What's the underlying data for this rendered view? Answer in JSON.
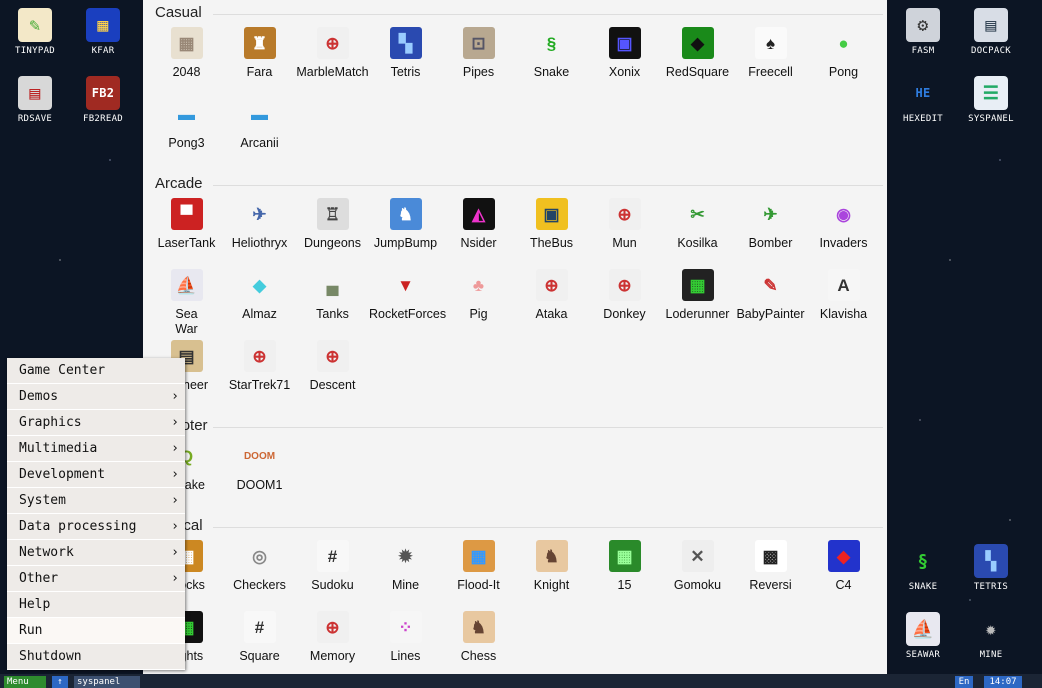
{
  "desktop_left": [
    {
      "label": "TINYPAD",
      "glyph": "✎",
      "bg": "#f3e8c8",
      "fg": "#4a3"
    },
    {
      "label": "KFAR",
      "glyph": "▦",
      "bg": "#1a3fbf",
      "fg": "#ffd24a"
    },
    {
      "label": "RDSAVE",
      "glyph": "▤",
      "bg": "#d8d8d8",
      "fg": "#b22"
    },
    {
      "label": "FB2READ",
      "glyph": "FB2",
      "bg": "#a02a22",
      "fg": "#fff"
    }
  ],
  "desktop_right": [
    {
      "label": "FASM",
      "glyph": "⚙",
      "bg": "#cfd3da",
      "fg": "#333"
    },
    {
      "label": "DOCPACK",
      "glyph": "▤",
      "bg": "#d8dde6",
      "fg": "#345"
    },
    {
      "label": "HEXEDIT",
      "glyph": "HE",
      "bg": "transparent",
      "fg": "#2f7de0"
    },
    {
      "label": "SYSPANEL",
      "glyph": "☰",
      "bg": "#e8eef5",
      "fg": "#2a6"
    },
    {
      "label": "SNAKE",
      "glyph": "§",
      "bg": "transparent",
      "fg": "#3c3"
    },
    {
      "label": "TETRIS",
      "glyph": "▚",
      "bg": "#2a4ab0",
      "fg": "#9cf"
    },
    {
      "label": "SEAWAR",
      "glyph": "⛵",
      "bg": "#e8e8f0",
      "fg": "#446"
    },
    {
      "label": "MINE",
      "glyph": "✹",
      "bg": "transparent",
      "fg": "#bbb"
    }
  ],
  "sections": [
    {
      "title": "Casual",
      "apps": [
        {
          "name": "2048",
          "glyph": "▦",
          "bg": "#e8e0d0",
          "fg": "#987"
        },
        {
          "name": "Fara",
          "glyph": "♜",
          "bg": "#b87a2a",
          "fg": "#fff"
        },
        {
          "name": "MarbleMatch",
          "glyph": "⊕",
          "bg": "#f0f0f0",
          "fg": "#c33"
        },
        {
          "name": "Tetris",
          "glyph": "▚",
          "bg": "#2a4ab0",
          "fg": "#9cf"
        },
        {
          "name": "Pipes",
          "glyph": "⊡",
          "bg": "#b8a890",
          "fg": "#556"
        },
        {
          "name": "Snake",
          "glyph": "§",
          "bg": "transparent",
          "fg": "#2a2"
        },
        {
          "name": "Xonix",
          "glyph": "▣",
          "bg": "#111",
          "fg": "#55f"
        },
        {
          "name": "RedSquare",
          "glyph": "◆",
          "bg": "#1a8a1a",
          "fg": "#111"
        },
        {
          "name": "Freecell",
          "glyph": "♠",
          "bg": "#fafafa",
          "fg": "#222"
        },
        {
          "name": "Pong",
          "glyph": "●",
          "bg": "transparent",
          "fg": "#4c4"
        },
        {
          "name": "Pong3",
          "glyph": "▬",
          "bg": "transparent",
          "fg": "#39d"
        },
        {
          "name": "Arcanii",
          "glyph": "▬",
          "bg": "transparent",
          "fg": "#39d"
        }
      ]
    },
    {
      "title": "Arcade",
      "apps": [
        {
          "name": "LaserTank",
          "glyph": "▀",
          "bg": "#c22",
          "fg": "#fff"
        },
        {
          "name": "Heliothryx",
          "glyph": "✈",
          "bg": "transparent",
          "fg": "#46a"
        },
        {
          "name": "Dungeons",
          "glyph": "♖",
          "bg": "#ddd",
          "fg": "#444"
        },
        {
          "name": "JumpBump",
          "glyph": "♞",
          "bg": "#4a8ad8",
          "fg": "#fff"
        },
        {
          "name": "Nsider",
          "glyph": "◭",
          "bg": "#111",
          "fg": "#e3c"
        },
        {
          "name": "TheBus",
          "glyph": "▣",
          "bg": "#f0c020",
          "fg": "#246"
        },
        {
          "name": "Mun",
          "glyph": "⊕",
          "bg": "#f0f0f0",
          "fg": "#c33"
        },
        {
          "name": "Kosilka",
          "glyph": "✂",
          "bg": "transparent",
          "fg": "#393"
        },
        {
          "name": "Bomber",
          "glyph": "✈",
          "bg": "transparent",
          "fg": "#393"
        },
        {
          "name": "Invaders",
          "glyph": "◉",
          "bg": "transparent",
          "fg": "#a4d"
        },
        {
          "name": "Sea\nWar",
          "glyph": "⛵",
          "bg": "#e8e8f0",
          "fg": "#446"
        },
        {
          "name": "Almaz",
          "glyph": "◆",
          "bg": "transparent",
          "fg": "#4cd"
        },
        {
          "name": "Tanks",
          "glyph": "▄",
          "bg": "transparent",
          "fg": "#786"
        },
        {
          "name": "RocketForces",
          "glyph": "▼",
          "bg": "transparent",
          "fg": "#c22"
        },
        {
          "name": "Pig",
          "glyph": "♣",
          "bg": "transparent",
          "fg": "#e99"
        },
        {
          "name": "Ataka",
          "glyph": "⊕",
          "bg": "#f0f0f0",
          "fg": "#c33"
        },
        {
          "name": "Donkey",
          "glyph": "⊕",
          "bg": "#f0f0f0",
          "fg": "#c33"
        },
        {
          "name": "Loderunner",
          "glyph": "▦",
          "bg": "#222",
          "fg": "#3c3"
        },
        {
          "name": "BabyPainter",
          "glyph": "✎",
          "bg": "transparent",
          "fg": "#c33"
        },
        {
          "name": "Klavisha",
          "glyph": "A",
          "bg": "#f6f6f6",
          "fg": "#333"
        },
        {
          "name": "Pioneer",
          "glyph": "▤",
          "bg": "#d8c090",
          "fg": "#333"
        },
        {
          "name": "StarTrek71",
          "glyph": "⊕",
          "bg": "#f0f0f0",
          "fg": "#c33"
        },
        {
          "name": "Descent",
          "glyph": "⊕",
          "bg": "#f0f0f0",
          "fg": "#c33"
        }
      ]
    },
    {
      "title": "Shooter",
      "apps": [
        {
          "name": "Quake",
          "glyph": "Q",
          "bg": "transparent",
          "fg": "#7a2"
        },
        {
          "name": "DOOM1",
          "glyph": "DOOM",
          "bg": "transparent",
          "fg": "#c63"
        }
      ]
    },
    {
      "title": "Logical",
      "apps": [
        {
          "name": "Blocks",
          "glyph": "▦",
          "bg": "#c82",
          "fg": "#fff"
        },
        {
          "name": "Checkers",
          "glyph": "◎",
          "bg": "transparent",
          "fg": "#888"
        },
        {
          "name": "Sudoku",
          "glyph": "#",
          "bg": "#f8f8f8",
          "fg": "#333"
        },
        {
          "name": "Mine",
          "glyph": "✹",
          "bg": "transparent",
          "fg": "#555"
        },
        {
          "name": "Flood-It",
          "glyph": "▦",
          "bg": "#d94",
          "fg": "#39f"
        },
        {
          "name": "Knight",
          "glyph": "♞",
          "bg": "#e8c8a0",
          "fg": "#643"
        },
        {
          "name": "15",
          "glyph": "▦",
          "bg": "#2a8a2a",
          "fg": "#9f9"
        },
        {
          "name": "Gomoku",
          "glyph": "✕",
          "bg": "#eee",
          "fg": "#555"
        },
        {
          "name": "Reversi",
          "glyph": "▩",
          "bg": "#fff",
          "fg": "#222"
        },
        {
          "name": "C4",
          "glyph": "◆",
          "bg": "#2233cc",
          "fg": "#e22"
        },
        {
          "name": "Lights",
          "glyph": "▦",
          "bg": "#111",
          "fg": "#3c3"
        },
        {
          "name": "Square",
          "glyph": "#",
          "bg": "#f8f8f8",
          "fg": "#333"
        },
        {
          "name": "Memory",
          "glyph": "⊕",
          "bg": "#f0f0f0",
          "fg": "#c33"
        },
        {
          "name": "Lines",
          "glyph": "⁘",
          "bg": "#f6f6f6",
          "fg": "#c4c"
        },
        {
          "name": "Chess",
          "glyph": "♞",
          "bg": "#e8c8a0",
          "fg": "#643"
        }
      ]
    }
  ],
  "menu": [
    {
      "label": "Game Center",
      "sub": false,
      "hl": false
    },
    {
      "label": "Demos",
      "sub": true,
      "hl": false
    },
    {
      "label": "Graphics",
      "sub": true,
      "hl": false
    },
    {
      "label": "Multimedia",
      "sub": true,
      "hl": false
    },
    {
      "label": "Development",
      "sub": true,
      "hl": false
    },
    {
      "label": "System",
      "sub": true,
      "hl": false
    },
    {
      "label": "Data processing",
      "sub": true,
      "hl": false
    },
    {
      "label": "Network",
      "sub": true,
      "hl": false
    },
    {
      "label": "Other",
      "sub": true,
      "hl": false
    },
    {
      "label": "Help",
      "sub": false,
      "hl": false
    },
    {
      "label": "Run",
      "sub": false,
      "hl": true
    },
    {
      "label": "Shutdown",
      "sub": false,
      "hl": false
    }
  ],
  "taskbar": {
    "menu_label": "Menu",
    "arrow": "↑",
    "task": "syspanel",
    "lang": "En",
    "clock": "14:07"
  }
}
